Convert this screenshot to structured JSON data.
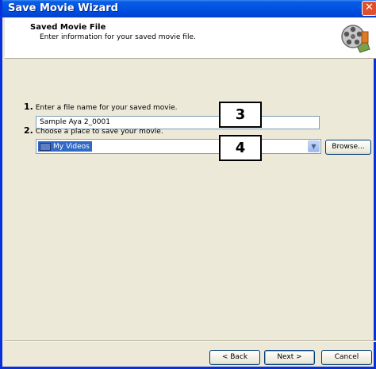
{
  "window": {
    "title": "Save Movie Wizard",
    "close_label": "✕"
  },
  "header": {
    "title": "Saved Movie File",
    "subtitle": "Enter information for your saved movie file.",
    "icon": "film-reel-icon"
  },
  "step1": {
    "number": "1.",
    "label": "Enter a file name for your saved movie.",
    "value": "Sample Aya 2_0001"
  },
  "step2": {
    "number": "2.",
    "label": "Choose a place to save your movie.",
    "selected": "My Videos",
    "browse_label": "Browse..."
  },
  "callouts": {
    "first": "3",
    "second": "4"
  },
  "buttons": {
    "back": "< Back",
    "next": "Next >",
    "cancel": "Cancel"
  },
  "colors": {
    "titlebar": "#0054e3",
    "selection": "#316ac5",
    "background": "#ece9d8"
  }
}
